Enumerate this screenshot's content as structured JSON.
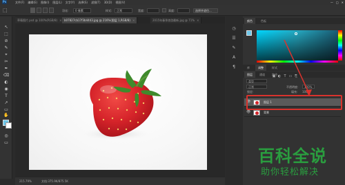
{
  "app": {
    "logo": "Ps"
  },
  "menu": {
    "items": [
      "文件(F)",
      "编辑(E)",
      "图像(I)",
      "图层(L)",
      "文字(Y)",
      "选择(S)",
      "滤镜(T)",
      "3D(D)",
      "视图(V)"
    ]
  },
  "window_buttons": [
    "—",
    "□",
    "✕"
  ],
  "options": {
    "feather_label": "羽化:",
    "feather_value": "0 像素",
    "style_label": "样式:",
    "style_value": "正常",
    "width_label": "宽度:",
    "height_label": "高度:",
    "select_mask_label": "选择并遮住..."
  },
  "tabs": [
    {
      "label": "草莓图片.psd @ 100%(RGB/8)",
      "active": false
    },
    {
      "label": "b07827cb17f3b4443.jpg @ 216%(图层 1,RGB/8)",
      "active": true
    },
    {
      "label": "2015年春季旅游最新.jpg @ 71%",
      "active": false
    }
  ],
  "tools": [
    "↖",
    "⬚",
    "⊘",
    "✎",
    "⌖",
    "✂",
    "✒",
    "⌫",
    "◐",
    "◉",
    "T",
    "↗",
    "▭",
    "✋",
    "🔍",
    "…"
  ],
  "status": {
    "zoom": "215.79%",
    "doc": "文档:375.9K/875.5K"
  },
  "right_panel": {
    "color_tabs": [
      "颜色",
      "色板"
    ],
    "adjust_tabs": [
      "库",
      "调整",
      "样式"
    ],
    "layers_tabs": [
      "图层",
      "通道",
      "路径"
    ],
    "kind_label": "类型",
    "blend_mode": "正常",
    "opacity_label": "不透明度:",
    "opacity_value": "100%",
    "lock_label": "锁定:",
    "fill_label": "填充:",
    "fill_value": "100%",
    "layers": [
      {
        "name": "图层 1",
        "selected": true
      },
      {
        "name": "背景",
        "selected": false
      }
    ]
  },
  "colors": {
    "foreground": "#6ec6e8",
    "background": "#ffffff",
    "highlight": "#d9332d"
  },
  "watermark": {
    "title": "百科全说",
    "subtitle": "助你轻松解决"
  },
  "icons": [
    "photoshop-logo",
    "move-icon",
    "marquee-icon",
    "lasso-icon",
    "eye-icon",
    "strawberry-thumbnail"
  ]
}
